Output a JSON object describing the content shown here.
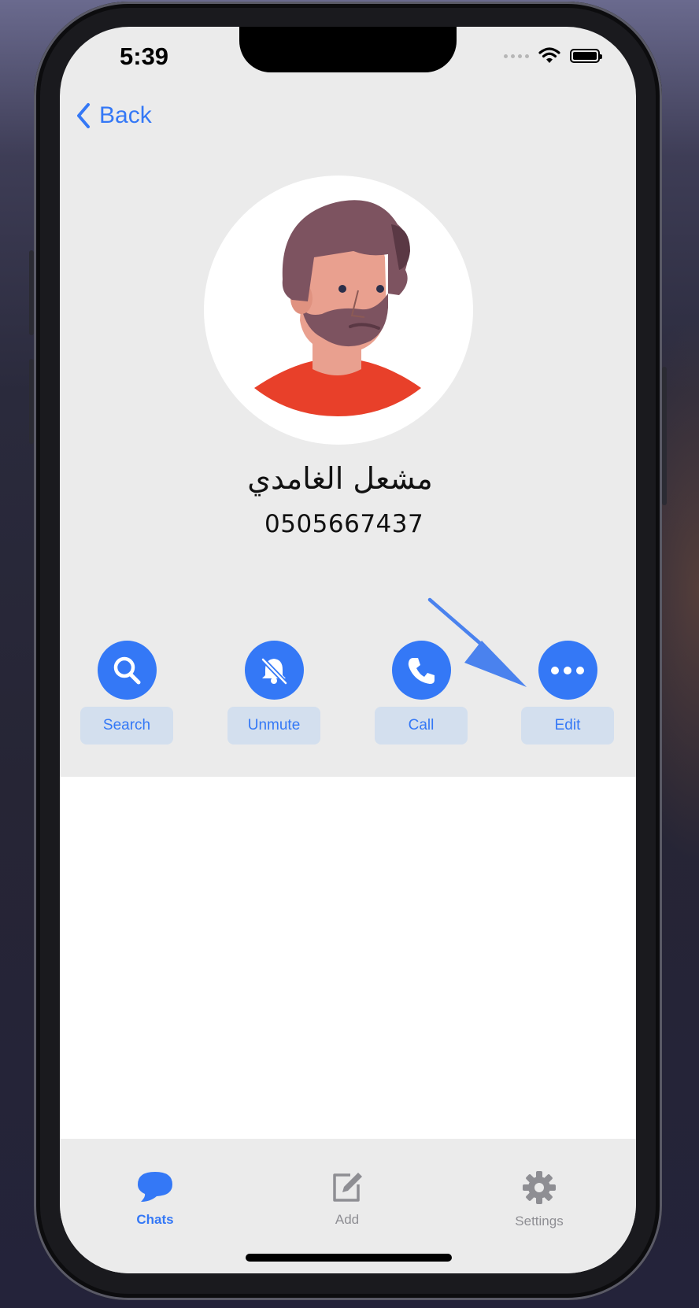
{
  "status_bar": {
    "time": "5:39",
    "icons": [
      "signal-dots-icon",
      "wifi-icon",
      "battery-icon"
    ]
  },
  "nav": {
    "back_label": "Back",
    "back_icon": "chevron-left-icon"
  },
  "contact": {
    "name": "مشعل الغامدي",
    "phone": "0505667437",
    "avatar_icon": "bearded-man-avatar"
  },
  "actions": [
    {
      "label": "Search",
      "icon": "magnifier-icon"
    },
    {
      "label": "Unmute",
      "icon": "bell-slash-icon"
    },
    {
      "label": "Call",
      "icon": "phone-icon"
    },
    {
      "label": "Edit",
      "icon": "ellipsis-icon"
    }
  ],
  "tabs": [
    {
      "label": "Chats",
      "icon": "chat-bubble-icon",
      "active": true
    },
    {
      "label": "Add",
      "icon": "compose-icon",
      "active": false
    },
    {
      "label": "Settings",
      "icon": "gear-icon",
      "active": false
    }
  ],
  "colors": {
    "accent": "#3478f6",
    "action_label_bg": "#d3dfee",
    "screen_bg": "#ebebeb",
    "inactive_tab": "#8e8e93"
  }
}
